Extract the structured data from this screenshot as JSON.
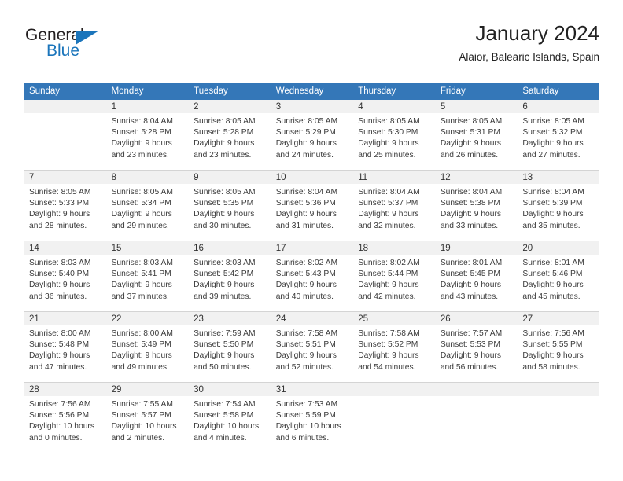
{
  "brand": {
    "word_one": "General",
    "word_two": "Blue",
    "accent_color": "#1b75bb",
    "triangle_icon": "brand-triangle-icon"
  },
  "header": {
    "title": "January 2024",
    "subtitle": "Alaior, Balearic Islands, Spain"
  },
  "calendar": {
    "header_bg": "#3477b8",
    "daynum_bg": "#f1f1f1",
    "weekdays": [
      "Sunday",
      "Monday",
      "Tuesday",
      "Wednesday",
      "Thursday",
      "Friday",
      "Saturday"
    ],
    "weeks": [
      [
        {
          "day": "",
          "empty": true,
          "sunrise": "",
          "sunset": "",
          "daylight_1": "",
          "daylight_2": ""
        },
        {
          "day": "1",
          "sunrise": "Sunrise: 8:04 AM",
          "sunset": "Sunset: 5:28 PM",
          "daylight_1": "Daylight: 9 hours",
          "daylight_2": "and 23 minutes."
        },
        {
          "day": "2",
          "sunrise": "Sunrise: 8:05 AM",
          "sunset": "Sunset: 5:28 PM",
          "daylight_1": "Daylight: 9 hours",
          "daylight_2": "and 23 minutes."
        },
        {
          "day": "3",
          "sunrise": "Sunrise: 8:05 AM",
          "sunset": "Sunset: 5:29 PM",
          "daylight_1": "Daylight: 9 hours",
          "daylight_2": "and 24 minutes."
        },
        {
          "day": "4",
          "sunrise": "Sunrise: 8:05 AM",
          "sunset": "Sunset: 5:30 PM",
          "daylight_1": "Daylight: 9 hours",
          "daylight_2": "and 25 minutes."
        },
        {
          "day": "5",
          "sunrise": "Sunrise: 8:05 AM",
          "sunset": "Sunset: 5:31 PM",
          "daylight_1": "Daylight: 9 hours",
          "daylight_2": "and 26 minutes."
        },
        {
          "day": "6",
          "sunrise": "Sunrise: 8:05 AM",
          "sunset": "Sunset: 5:32 PM",
          "daylight_1": "Daylight: 9 hours",
          "daylight_2": "and 27 minutes."
        }
      ],
      [
        {
          "day": "7",
          "sunrise": "Sunrise: 8:05 AM",
          "sunset": "Sunset: 5:33 PM",
          "daylight_1": "Daylight: 9 hours",
          "daylight_2": "and 28 minutes."
        },
        {
          "day": "8",
          "sunrise": "Sunrise: 8:05 AM",
          "sunset": "Sunset: 5:34 PM",
          "daylight_1": "Daylight: 9 hours",
          "daylight_2": "and 29 minutes."
        },
        {
          "day": "9",
          "sunrise": "Sunrise: 8:05 AM",
          "sunset": "Sunset: 5:35 PM",
          "daylight_1": "Daylight: 9 hours",
          "daylight_2": "and 30 minutes."
        },
        {
          "day": "10",
          "sunrise": "Sunrise: 8:04 AM",
          "sunset": "Sunset: 5:36 PM",
          "daylight_1": "Daylight: 9 hours",
          "daylight_2": "and 31 minutes."
        },
        {
          "day": "11",
          "sunrise": "Sunrise: 8:04 AM",
          "sunset": "Sunset: 5:37 PM",
          "daylight_1": "Daylight: 9 hours",
          "daylight_2": "and 32 minutes."
        },
        {
          "day": "12",
          "sunrise": "Sunrise: 8:04 AM",
          "sunset": "Sunset: 5:38 PM",
          "daylight_1": "Daylight: 9 hours",
          "daylight_2": "and 33 minutes."
        },
        {
          "day": "13",
          "sunrise": "Sunrise: 8:04 AM",
          "sunset": "Sunset: 5:39 PM",
          "daylight_1": "Daylight: 9 hours",
          "daylight_2": "and 35 minutes."
        }
      ],
      [
        {
          "day": "14",
          "sunrise": "Sunrise: 8:03 AM",
          "sunset": "Sunset: 5:40 PM",
          "daylight_1": "Daylight: 9 hours",
          "daylight_2": "and 36 minutes."
        },
        {
          "day": "15",
          "sunrise": "Sunrise: 8:03 AM",
          "sunset": "Sunset: 5:41 PM",
          "daylight_1": "Daylight: 9 hours",
          "daylight_2": "and 37 minutes."
        },
        {
          "day": "16",
          "sunrise": "Sunrise: 8:03 AM",
          "sunset": "Sunset: 5:42 PM",
          "daylight_1": "Daylight: 9 hours",
          "daylight_2": "and 39 minutes."
        },
        {
          "day": "17",
          "sunrise": "Sunrise: 8:02 AM",
          "sunset": "Sunset: 5:43 PM",
          "daylight_1": "Daylight: 9 hours",
          "daylight_2": "and 40 minutes."
        },
        {
          "day": "18",
          "sunrise": "Sunrise: 8:02 AM",
          "sunset": "Sunset: 5:44 PM",
          "daylight_1": "Daylight: 9 hours",
          "daylight_2": "and 42 minutes."
        },
        {
          "day": "19",
          "sunrise": "Sunrise: 8:01 AM",
          "sunset": "Sunset: 5:45 PM",
          "daylight_1": "Daylight: 9 hours",
          "daylight_2": "and 43 minutes."
        },
        {
          "day": "20",
          "sunrise": "Sunrise: 8:01 AM",
          "sunset": "Sunset: 5:46 PM",
          "daylight_1": "Daylight: 9 hours",
          "daylight_2": "and 45 minutes."
        }
      ],
      [
        {
          "day": "21",
          "sunrise": "Sunrise: 8:00 AM",
          "sunset": "Sunset: 5:48 PM",
          "daylight_1": "Daylight: 9 hours",
          "daylight_2": "and 47 minutes."
        },
        {
          "day": "22",
          "sunrise": "Sunrise: 8:00 AM",
          "sunset": "Sunset: 5:49 PM",
          "daylight_1": "Daylight: 9 hours",
          "daylight_2": "and 49 minutes."
        },
        {
          "day": "23",
          "sunrise": "Sunrise: 7:59 AM",
          "sunset": "Sunset: 5:50 PM",
          "daylight_1": "Daylight: 9 hours",
          "daylight_2": "and 50 minutes."
        },
        {
          "day": "24",
          "sunrise": "Sunrise: 7:58 AM",
          "sunset": "Sunset: 5:51 PM",
          "daylight_1": "Daylight: 9 hours",
          "daylight_2": "and 52 minutes."
        },
        {
          "day": "25",
          "sunrise": "Sunrise: 7:58 AM",
          "sunset": "Sunset: 5:52 PM",
          "daylight_1": "Daylight: 9 hours",
          "daylight_2": "and 54 minutes."
        },
        {
          "day": "26",
          "sunrise": "Sunrise: 7:57 AM",
          "sunset": "Sunset: 5:53 PM",
          "daylight_1": "Daylight: 9 hours",
          "daylight_2": "and 56 minutes."
        },
        {
          "day": "27",
          "sunrise": "Sunrise: 7:56 AM",
          "sunset": "Sunset: 5:55 PM",
          "daylight_1": "Daylight: 9 hours",
          "daylight_2": "and 58 minutes."
        }
      ],
      [
        {
          "day": "28",
          "sunrise": "Sunrise: 7:56 AM",
          "sunset": "Sunset: 5:56 PM",
          "daylight_1": "Daylight: 10 hours",
          "daylight_2": "and 0 minutes."
        },
        {
          "day": "29",
          "sunrise": "Sunrise: 7:55 AM",
          "sunset": "Sunset: 5:57 PM",
          "daylight_1": "Daylight: 10 hours",
          "daylight_2": "and 2 minutes."
        },
        {
          "day": "30",
          "sunrise": "Sunrise: 7:54 AM",
          "sunset": "Sunset: 5:58 PM",
          "daylight_1": "Daylight: 10 hours",
          "daylight_2": "and 4 minutes."
        },
        {
          "day": "31",
          "sunrise": "Sunrise: 7:53 AM",
          "sunset": "Sunset: 5:59 PM",
          "daylight_1": "Daylight: 10 hours",
          "daylight_2": "and 6 minutes."
        },
        {
          "day": "",
          "empty": true,
          "sunrise": "",
          "sunset": "",
          "daylight_1": "",
          "daylight_2": ""
        },
        {
          "day": "",
          "empty": true,
          "sunrise": "",
          "sunset": "",
          "daylight_1": "",
          "daylight_2": ""
        },
        {
          "day": "",
          "empty": true,
          "sunrise": "",
          "sunset": "",
          "daylight_1": "",
          "daylight_2": ""
        }
      ]
    ]
  }
}
